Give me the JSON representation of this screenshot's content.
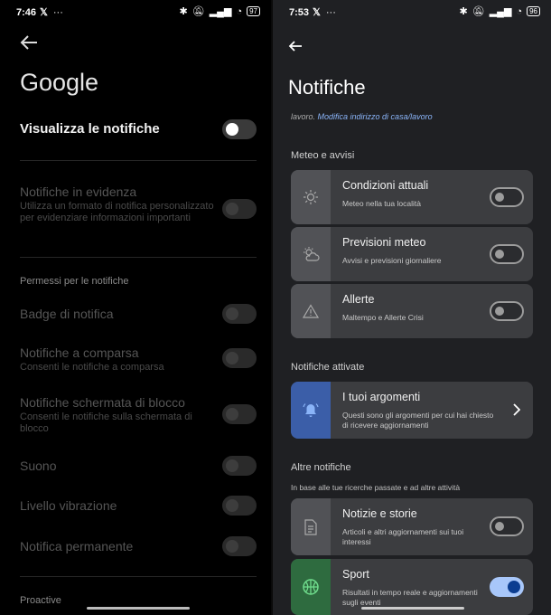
{
  "left": {
    "time": "7:46",
    "battery": "97",
    "title": "Google",
    "show_notifications": "Visualizza le notifiche",
    "featured_title": "Notifiche in evidenza",
    "featured_sub": "Utilizza un formato di notifica personalizzato per evidenziare informazioni importanti",
    "perm_section": "Permessi per le notifiche",
    "badge": "Badge di notifica",
    "popup_title": "Notifiche a comparsa",
    "popup_sub": "Consenti le notifiche a comparsa",
    "lock_title": "Notifiche schermata di blocco",
    "lock_sub": "Consenti le notifiche sulla schermata di blocco",
    "sound": "Suono",
    "vibration": "Livello vibrazione",
    "permanent": "Notifica permanente",
    "proactive": "Proactive"
  },
  "right": {
    "time": "7:53",
    "battery": "96",
    "title": "Notifiche",
    "crumb_prefix": "lavoro.",
    "crumb_link": "Modifica indirizzo di casa/lavoro",
    "sec_weather": "Meteo e avvisi",
    "cards_weather": [
      {
        "title": "Condizioni attuali",
        "sub": "Meteo nella tua località"
      },
      {
        "title": "Previsioni meteo",
        "sub": "Avvisi e previsioni giornaliere"
      },
      {
        "title": "Allerte",
        "sub": "Maltempo e Allerte Crisi"
      }
    ],
    "sec_active": "Notifiche attivate",
    "topics": {
      "title": "I tuoi argomenti",
      "sub": "Questi sono gli argomenti per cui hai chiesto di ricevere aggiornamenti"
    },
    "sec_other": "Altre notifiche",
    "sec_other_sub": "In base alle tue ricerche passate e ad altre attività",
    "news": {
      "title": "Notizie e storie",
      "sub": "Articoli e altri aggiornamenti sui tuoi interessi"
    },
    "sport": {
      "title": "Sport",
      "sub": "Risultati in tempo reale e aggiornamenti sugli eventi"
    }
  },
  "colors": {
    "accent": "#a8c7fa",
    "toggle_on_knob": "#0b3d91",
    "topic_icon_bg": "#3b5ea8"
  }
}
